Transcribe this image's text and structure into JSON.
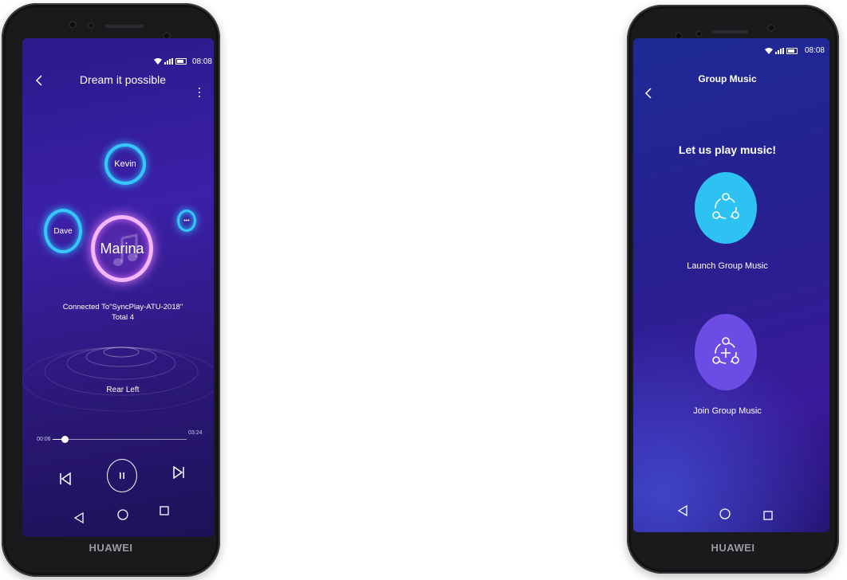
{
  "device": {
    "brand": "HUAWEI"
  },
  "player_screen": {
    "status": {
      "time": "08:08"
    },
    "header": {
      "title": "Dream it possible"
    },
    "devices": {
      "center": "Marina",
      "top": "Kevin",
      "left": "Dave",
      "right_small": "•••"
    },
    "connection": {
      "line1": "Connected To\"SyncPlay-ATU-2018\"",
      "line2": "Total 4"
    },
    "speaker_position": "Rear Left",
    "progress": {
      "elapsed": "00:06",
      "total": "03:24",
      "fraction": 0.09
    }
  },
  "group_screen": {
    "status": {
      "time": "08:08"
    },
    "header": {
      "title": "Group Music"
    },
    "headline": "Let us play music!",
    "launch_label": "Launch Group Music",
    "join_label": "Join Group Music",
    "colors": {
      "launch": "#2ec2f2",
      "join": "#6b4de6"
    }
  }
}
